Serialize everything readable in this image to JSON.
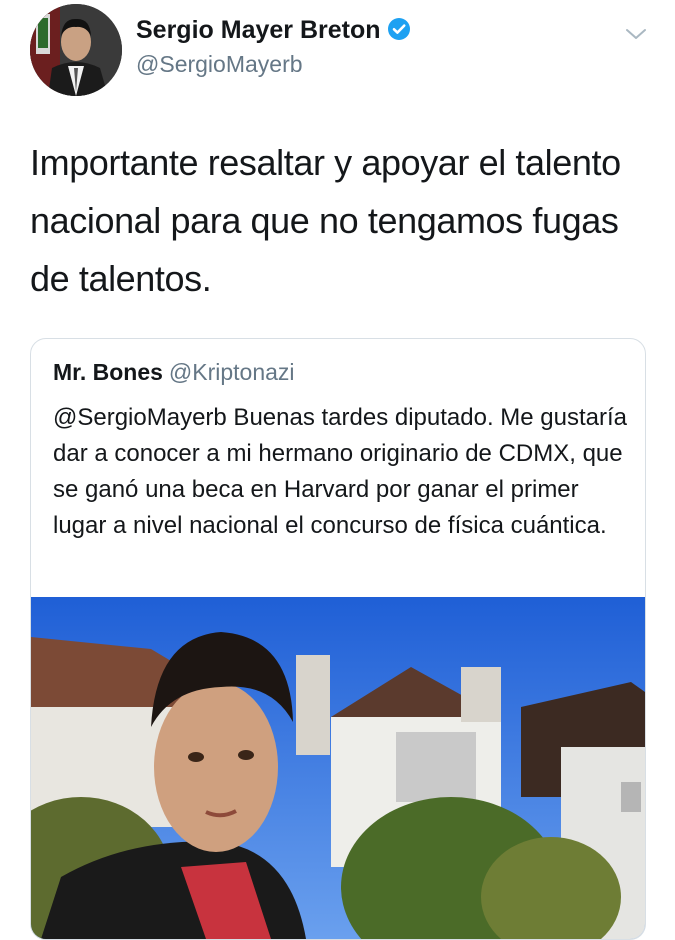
{
  "author": {
    "display_name": "Sergio Mayer Breton",
    "handle": "@SergioMayerb",
    "verified": true
  },
  "tweet": {
    "text": "Importante resaltar y apoyar el talento nacional para que no tengamos fugas de talentos."
  },
  "quoted_tweet": {
    "display_name": "Mr. Bones",
    "handle": "@Kriptonazi",
    "text": "@SergioMayerb Buenas tardes diputado. Me gustaría dar a conocer a mi hermano originario de CDMX, que se ganó una beca en Harvard por ganar el primer lugar a nivel nacional el concurso de física cuántica."
  },
  "icons": {
    "verified": "verified-badge-icon",
    "menu": "chevron-down-icon"
  },
  "colors": {
    "verified_blue": "#1da1f2",
    "secondary_text": "#657786",
    "border": "#d8dfe5"
  }
}
